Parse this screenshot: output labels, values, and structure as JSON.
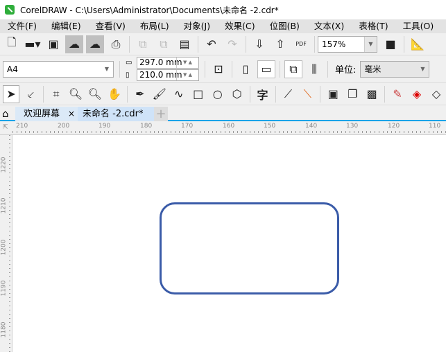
{
  "title": "CorelDRAW - C:\\Users\\Administrator\\Documents\\未命名 -2.cdr*",
  "menu": [
    "文件(F)",
    "编辑(E)",
    "查看(V)",
    "布局(L)",
    "对象(J)",
    "效果(C)",
    "位图(B)",
    "文本(X)",
    "表格(T)",
    "工具(O)"
  ],
  "toolbar": {
    "zoom": "157%",
    "pdf": "PDF"
  },
  "propbar": {
    "page_size": "A4",
    "width": "297.0 mm",
    "height": "210.0 mm",
    "units_label": "单位:",
    "units": "毫米"
  },
  "toolbox": {
    "text_tool": "字"
  },
  "tabs": [
    {
      "label": "欢迎屏幕",
      "close": "×"
    },
    {
      "label": "未命名 -2.cdr*"
    }
  ],
  "tab_add": "+",
  "ruler_h": [
    "210",
    "200",
    "190",
    "180",
    "170",
    "160",
    "150",
    "140",
    "130",
    "120",
    "110"
  ],
  "ruler_v": [
    "1220",
    "1210",
    "1200",
    "1190",
    "1180"
  ],
  "colors": {
    "shape_stroke": "#3a5ba8",
    "tab_accent": "#1aa3e8"
  }
}
